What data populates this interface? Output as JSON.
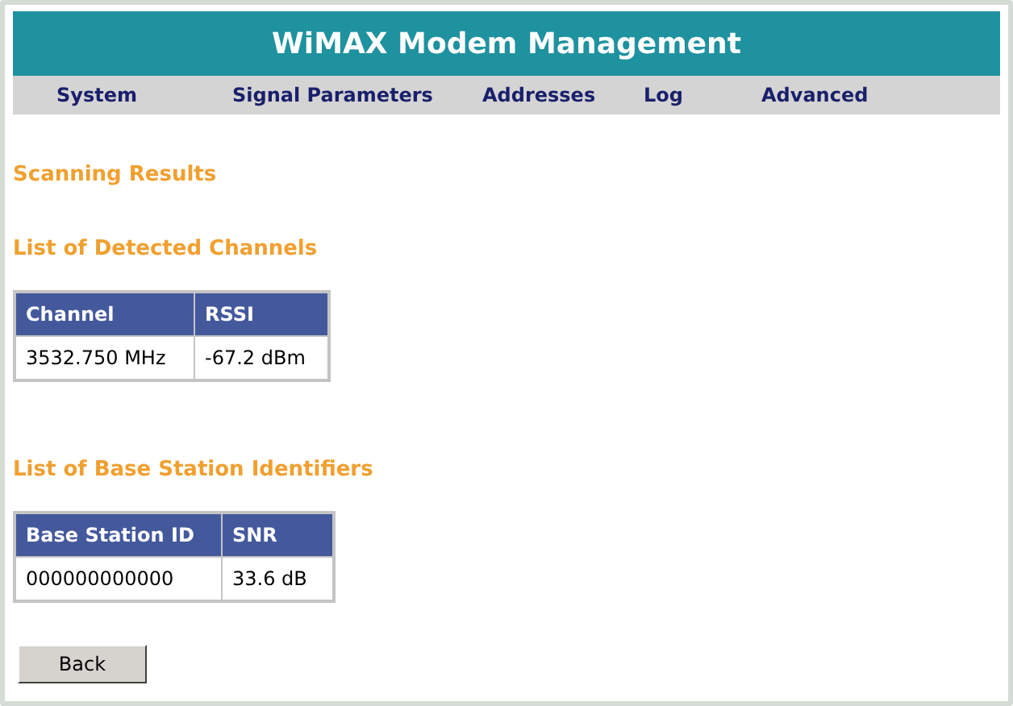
{
  "header": {
    "title": "WiMAX Modem Management"
  },
  "nav": [
    "System",
    "Signal Parameters",
    "Addresses",
    "Log",
    "Advanced"
  ],
  "page_title": "Scanning Results",
  "sections": [
    {
      "heading": "List of Detected Channels",
      "columns": [
        "Channel",
        "RSSI"
      ],
      "rows": [
        [
          "3532.750 MHz",
          "-67.2 dBm"
        ]
      ]
    },
    {
      "heading": "List of Base Station Identifiers",
      "columns": [
        "Base Station ID",
        "SNR"
      ],
      "rows": [
        [
          "000000000000",
          "33.6 dB"
        ]
      ]
    }
  ],
  "back_button": "Back"
}
